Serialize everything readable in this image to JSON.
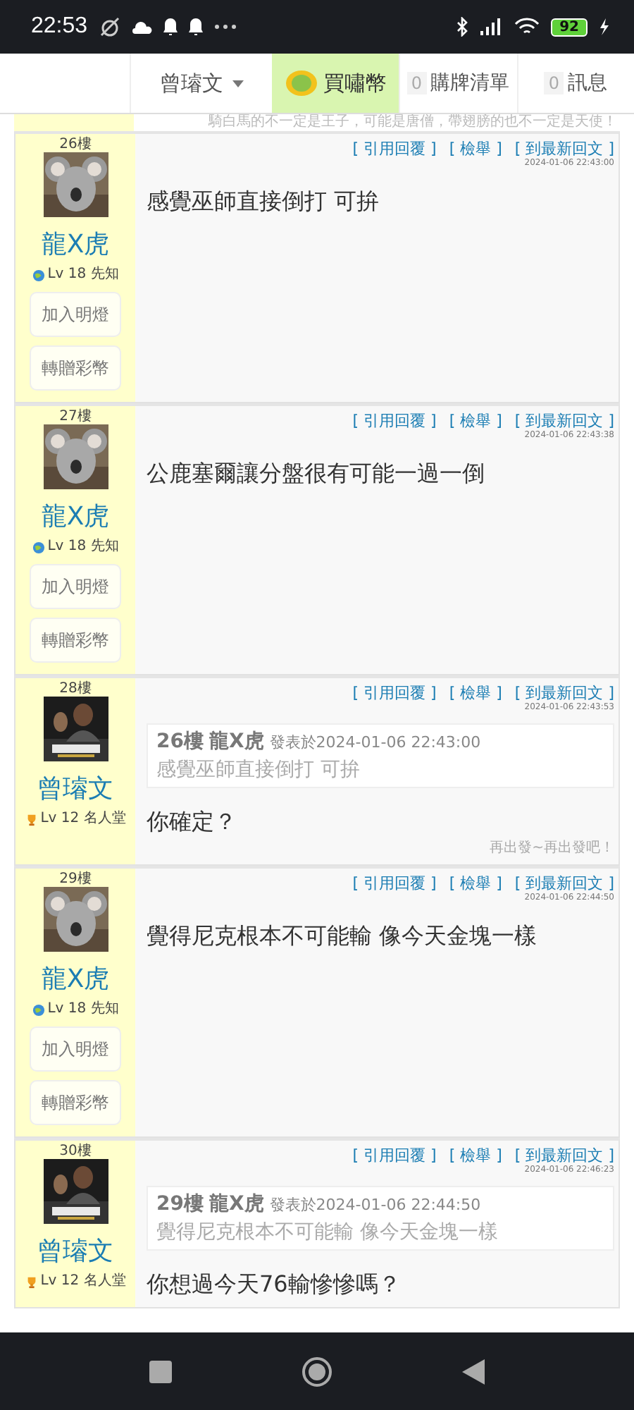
{
  "status_bar": {
    "time": "22:53",
    "battery": "92"
  },
  "header": {
    "user_menu": "曾璿文",
    "buy_coins": "買嘯幣",
    "cart": {
      "count": "0",
      "label": "購牌清單"
    },
    "messages": {
      "count": "0",
      "label": "訊息"
    }
  },
  "banner": "騎白馬的不一定是王子，可能是唐僧，帶翅膀的也不一定是天使！",
  "posts": [
    {
      "floor": "26樓",
      "author": "龍X虎",
      "badge": {
        "kind": "globe",
        "text": "Lv 18 先知"
      },
      "buttons": [
        "加入明燈",
        "轉贈彩幣"
      ],
      "actions": [
        "[ 引用回覆 ]",
        "[ 檢舉 ]",
        "[ 到最新回文 ]"
      ],
      "timestamp": "2024-01-06 22:43:00",
      "body": [
        "感覺巫師直接倒打 可拚"
      ]
    },
    {
      "floor": "27樓",
      "author": "龍X虎",
      "badge": {
        "kind": "globe",
        "text": "Lv 18 先知"
      },
      "buttons": [
        "加入明燈",
        "轉贈彩幣"
      ],
      "actions": [
        "[ 引用回覆 ]",
        "[ 檢舉 ]",
        "[ 到最新回文 ]"
      ],
      "timestamp": "2024-01-06 22:43:38",
      "body": [
        "公鹿塞爾讓分盤很有可能一過一倒"
      ]
    },
    {
      "floor": "28樓",
      "author": "曾璿文",
      "badge": {
        "kind": "trophy",
        "text": "Lv 12 名人堂"
      },
      "actions": [
        "[ 引用回覆 ]",
        "[ 檢舉 ]",
        "[ 到最新回文 ]"
      ],
      "timestamp": "2024-01-06 22:43:53",
      "quote": {
        "floor": "26樓",
        "author": "龍X虎",
        "meta": "發表於2024-01-06 22:43:00",
        "text": "感覺巫師直接倒打 可拚"
      },
      "body": [
        "你確定？"
      ],
      "signature": "再出發~再出發吧！"
    },
    {
      "floor": "29樓",
      "author": "龍X虎",
      "badge": {
        "kind": "globe",
        "text": "Lv 18 先知"
      },
      "buttons": [
        "加入明燈",
        "轉贈彩幣"
      ],
      "actions": [
        "[ 引用回覆 ]",
        "[ 檢舉 ]",
        "[ 到最新回文 ]"
      ],
      "timestamp": "2024-01-06 22:44:50",
      "body": [
        "覺得尼克根本不可能輸 像今天金塊一樣"
      ]
    },
    {
      "floor": "30樓",
      "author": "曾璿文",
      "badge": {
        "kind": "trophy",
        "text": "Lv 12 名人堂"
      },
      "actions": [
        "[ 引用回覆 ]",
        "[ 檢舉 ]",
        "[ 到最新回文 ]"
      ],
      "timestamp": "2024-01-06 22:46:23",
      "quote": {
        "floor": "29樓",
        "author": "龍X虎",
        "meta": "發表於2024-01-06 22:44:50",
        "text": "覺得尼克根本不可能輸 像今天金塊一樣"
      },
      "body": [
        "你想過今天76輸慘慘嗎？"
      ]
    }
  ]
}
